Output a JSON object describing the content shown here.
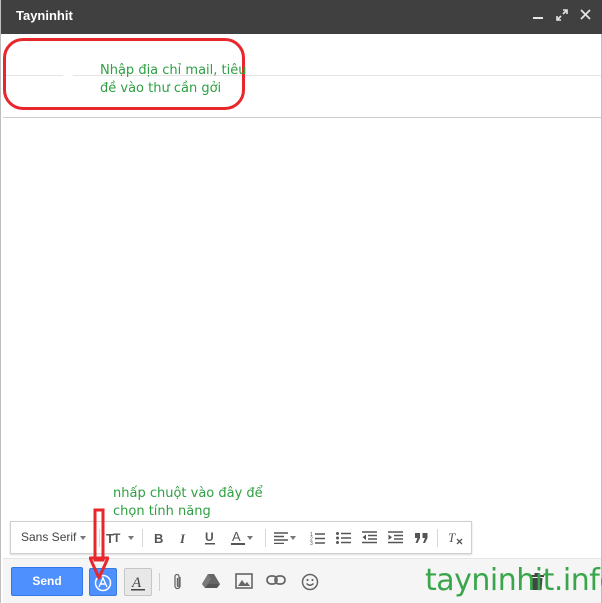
{
  "window": {
    "title": "Tayninhit",
    "controls": [
      "minimize-icon",
      "expand-icon",
      "close-icon"
    ]
  },
  "annotations": {
    "header_note_line1": "Nhập địa chỉ mail, tiêu",
    "header_note_line2": "đề vào thư cần gởi",
    "feature_note_line1": "nhấp chuột vào đây để",
    "feature_note_line2": "chọn tính năng"
  },
  "format_bar": {
    "font_family": "Sans Serif",
    "items": [
      "font-size-icon",
      "bold-icon",
      "italic-icon",
      "underline-icon",
      "text-color-icon",
      "align-icon",
      "numbered-list-icon",
      "bulleted-list-icon",
      "indent-less-icon",
      "indent-more-icon",
      "quote-icon",
      "remove-formatting-icon"
    ]
  },
  "toolbar": {
    "send_label": "Send",
    "items": [
      "translate-icon",
      "formatting-options-icon",
      "attach-icon",
      "drive-icon",
      "photo-icon",
      "link-icon",
      "emoji-icon",
      "trash-icon"
    ]
  },
  "colors": {
    "titlebar": "#404040",
    "send": "#4d90fe",
    "annotation": "#2ea043",
    "highlight": "#e8272c",
    "watermark": "#3aa64b"
  },
  "watermark": "tayninhit.info"
}
